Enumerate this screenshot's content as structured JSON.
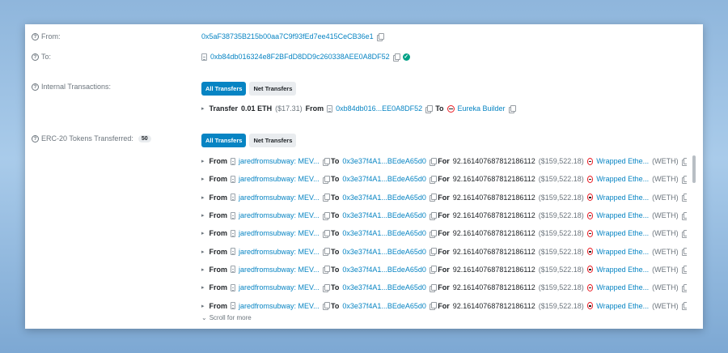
{
  "from": {
    "label": "From:",
    "address": "0x5aF38735B215b00aa7C9f93fEd7ee415CeCB36e1"
  },
  "to": {
    "label": "To:",
    "address": "0xb84db016324e8F2BFdD8DD9c260338AEE0A8DF52"
  },
  "internal": {
    "label": "Internal Transactions:",
    "tabs": [
      "All Transfers",
      "Net Transfers"
    ],
    "transfer": {
      "prefix": "Transfer",
      "amount": "0.01 ETH",
      "usd": "($17.31)",
      "from_kw": "From",
      "from_addr": "0xb84db016...EE0A8DF52",
      "to_kw": "To",
      "to_name": "Eureka Builder"
    }
  },
  "erc20": {
    "label": "ERC-20 Tokens Transferred:",
    "count": "50",
    "tabs": [
      "All Transfers",
      "Net Transfers"
    ],
    "row_template": {
      "from_kw": "From",
      "from_name": "jaredfromsubway: MEV...",
      "to_kw": "To",
      "to_addr": "0x3e37f4A1...BEdeA65d0",
      "for_kw": "For",
      "amount": "92.161407687812186112",
      "usd": "($159,522.18)",
      "token": "Wrapped Ethe...",
      "symbol": "(WETH)"
    },
    "visible_rows": 9,
    "scroll_more": "Scroll for more"
  },
  "colors": {
    "link": "#0784c3",
    "tab_active": "#0784c3",
    "verified": "#00a186",
    "weth_ring": "#ec1c24"
  }
}
